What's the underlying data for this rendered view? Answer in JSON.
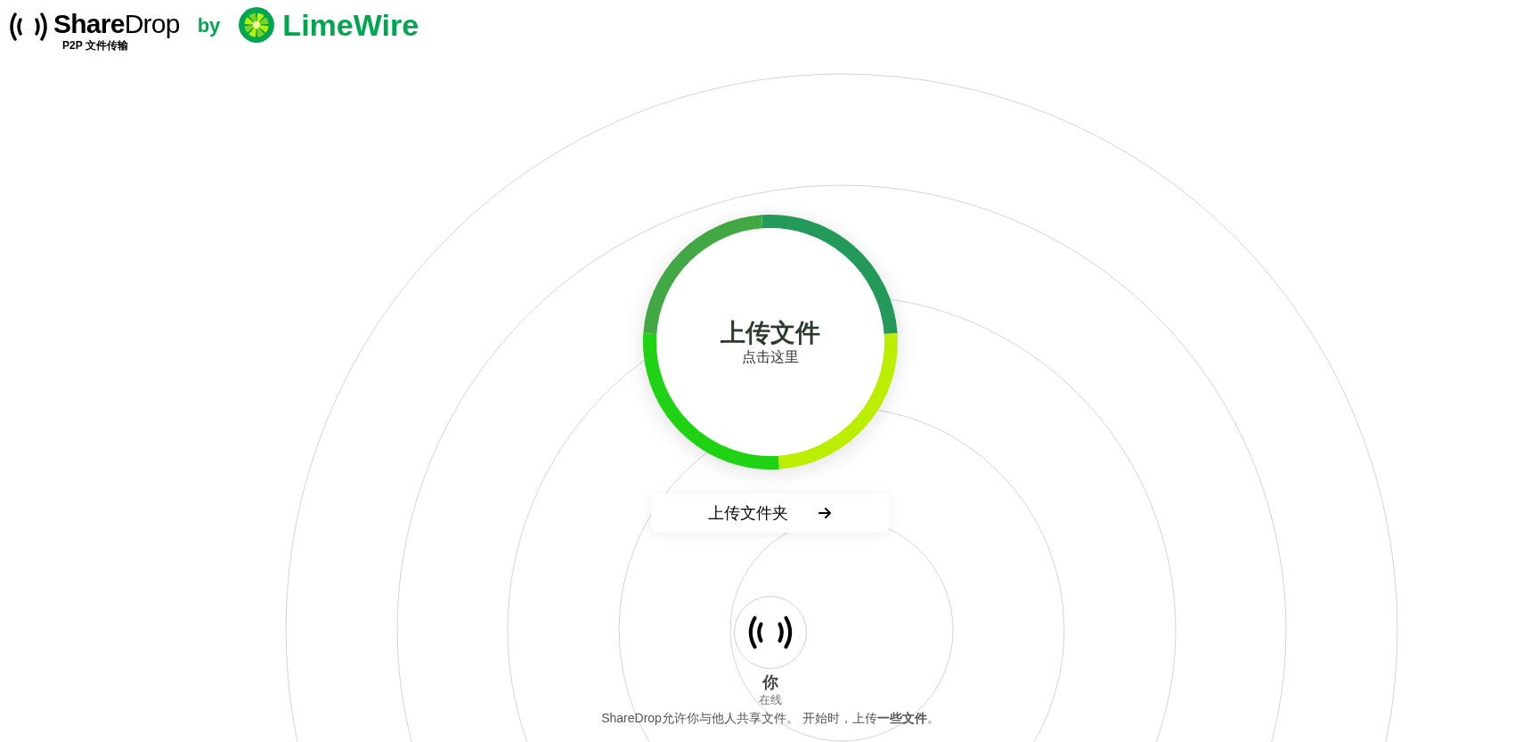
{
  "header": {
    "brand": "**Share**Drop",
    "tagline": "P2P 文件传输",
    "by": "by",
    "partner": "LimeWire"
  },
  "upload": {
    "title": "上传文件",
    "subtitle": "点击这里"
  },
  "folder_button": {
    "label": "上传文件夹"
  },
  "user": {
    "name": "你",
    "status": "在线"
  },
  "footer": "ShareDrop允许你与他人共享文件。 开始时，上传**一些文件**。"
}
